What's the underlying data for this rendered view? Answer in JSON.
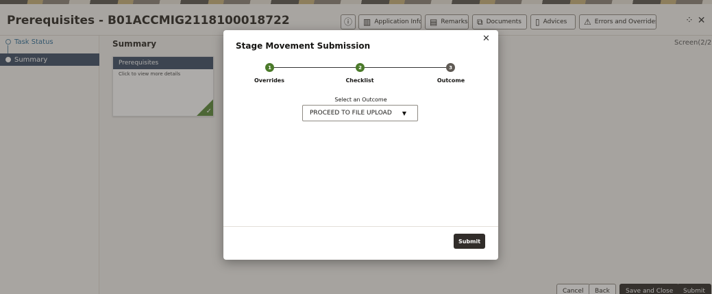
{
  "app": {
    "title": "Prerequisites - B01ACCMIG2118100018722"
  },
  "header_buttons": [
    {
      "label": "",
      "icon": "info-icon"
    },
    {
      "label": "Application Info",
      "icon": "grid-icon"
    },
    {
      "label": "Remarks",
      "icon": "comment-icon"
    },
    {
      "label": "Documents",
      "icon": "documents-icon"
    },
    {
      "label": "Advices",
      "icon": "advice-icon"
    },
    {
      "label": "Errors and Overrides",
      "icon": "warning-icon"
    }
  ],
  "sidebar": {
    "items": [
      {
        "label": "Task Status"
      },
      {
        "label": "Summary"
      }
    ]
  },
  "main": {
    "title": "Summary",
    "screen": "Screen(2/2)",
    "card": {
      "title": "Prerequisites",
      "subtitle": "Click to view more details"
    }
  },
  "footer": {
    "cancel": "Cancel",
    "back": "Back",
    "save_close": "Save and Close",
    "submit": "Submit"
  },
  "modal": {
    "title": "Stage Movement Submission",
    "close_icon": "close-icon",
    "steps": [
      {
        "number": "1",
        "label": "Overrides",
        "state": "done"
      },
      {
        "number": "2",
        "label": "Checklist",
        "state": "done"
      },
      {
        "number": "3",
        "label": "Outcome",
        "state": "todo"
      }
    ],
    "outcome_label": "Select an Outcome",
    "outcome_value": "PROCEED TO FILE UPLOAD",
    "submit": "Submit"
  },
  "colors": {
    "accent_dark": "#312d2a",
    "step_done": "#4b7a2a",
    "sidebar_active": "#3d4f66"
  }
}
